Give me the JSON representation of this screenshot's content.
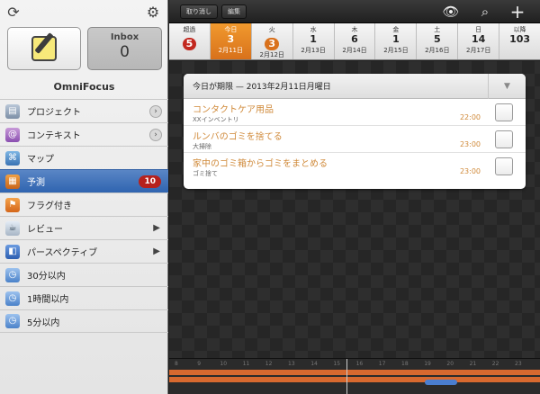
{
  "sidebar": {
    "inbox_label": "Inbox",
    "inbox_count": "0",
    "app_name": "OmniFocus",
    "items": [
      {
        "label": "プロジェクト",
        "icon": "projects-icon",
        "accessory": "chevron-circle"
      },
      {
        "label": "コンテキスト",
        "icon": "contexts-icon",
        "accessory": "chevron-circle"
      },
      {
        "label": "マップ",
        "icon": "map-icon",
        "accessory": ""
      },
      {
        "label": "予測",
        "icon": "forecast-icon",
        "accessory": "badge",
        "badge": "10",
        "selected": true
      },
      {
        "label": "フラグ付き",
        "icon": "flag-icon",
        "accessory": ""
      },
      {
        "label": "レビュー",
        "icon": "review-icon",
        "accessory": "arrow"
      },
      {
        "label": "パースペクティブ",
        "icon": "perspective-icon",
        "accessory": "arrow"
      },
      {
        "label": "30分以内",
        "icon": "clock-icon",
        "accessory": ""
      },
      {
        "label": "1時間以内",
        "icon": "clock-icon",
        "accessory": ""
      },
      {
        "label": "5分以内",
        "icon": "clock-icon",
        "accessory": ""
      }
    ]
  },
  "toolbar": {
    "cancel_label": "取り消し",
    "edit_label": "編集"
  },
  "calendar": [
    {
      "day": "超過",
      "num": "5",
      "date": "",
      "style": "red"
    },
    {
      "day": "今日",
      "num": "3",
      "date": "2月11日",
      "style": "today"
    },
    {
      "day": "火",
      "num": "3",
      "date": "2月12日",
      "style": "orange"
    },
    {
      "day": "水",
      "num": "1",
      "date": "2月13日",
      "style": ""
    },
    {
      "day": "木",
      "num": "6",
      "date": "2月14日",
      "style": ""
    },
    {
      "day": "金",
      "num": "1",
      "date": "2月15日",
      "style": ""
    },
    {
      "day": "土",
      "num": "5",
      "date": "2月16日",
      "style": ""
    },
    {
      "day": "日",
      "num": "14",
      "date": "2月17日",
      "style": ""
    },
    {
      "day": "以降",
      "num": "103",
      "date": "",
      "style": ""
    }
  ],
  "card": {
    "title": "今日が期限 — 2013年2月11日月曜日",
    "toggle": "▼",
    "tasks": [
      {
        "title": "コンタクトケア用品",
        "context": "XXインベントリ",
        "time": "22:00"
      },
      {
        "title": "ルンバのゴミを捨てる",
        "context": "大掃除",
        "time": "23:00"
      },
      {
        "title": "家中のゴミ箱からゴミをまとめる",
        "context": "ゴミ捨て",
        "time": "23:00"
      }
    ]
  },
  "timeline": {
    "hours": [
      "8",
      "9",
      "10",
      "11",
      "12",
      "13",
      "14",
      "15",
      "16",
      "17",
      "18",
      "19",
      "20",
      "21",
      "22",
      "23"
    ]
  },
  "colors": {
    "accent_orange": "#d8711b",
    "badge_red": "#b6211d",
    "selected_blue": "#3a6ab3",
    "task_orange": "#d08a3a"
  }
}
